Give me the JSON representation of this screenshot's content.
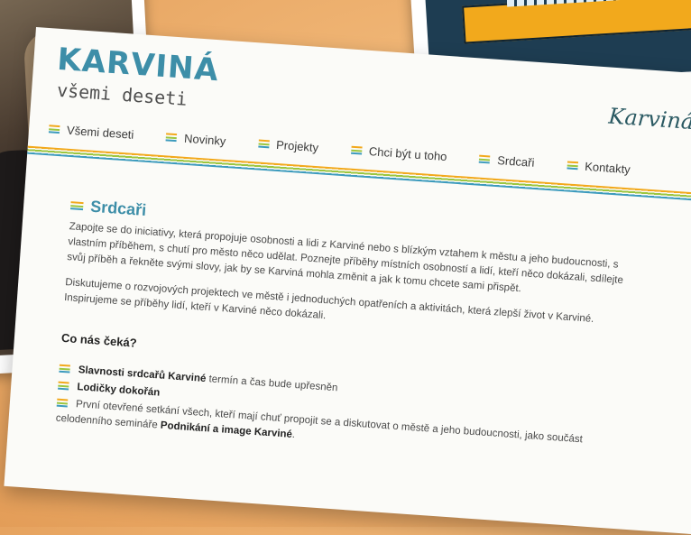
{
  "site": {
    "logo_title": "KARVINÁ",
    "logo_subtitle": "všemi deseti",
    "corner_logo": "Karviná"
  },
  "nav": {
    "items": [
      {
        "label": "Všemi deseti"
      },
      {
        "label": "Novinky"
      },
      {
        "label": "Projekty"
      },
      {
        "label": "Chci být u toho"
      },
      {
        "label": "Srdcaři"
      },
      {
        "label": "Kontakty"
      }
    ]
  },
  "page": {
    "section_title": "Srdcaři",
    "paragraph1": "Zapojte se do iniciativy, která propojuje osobnosti a lidi z Karviné nebo s blízkým vztahem k městu a jeho budoucnosti, s vlastním příběhem, s chutí pro město něco udělat. Poznejte příběhy místních osobností a lidí, kteří něco dokázali, sdílejte svůj příběh a řekněte svými slovy, jak by se Karviná mohla změnit a jak k tomu chcete sami přispět.",
    "paragraph2": "Diskutujeme o rozvojových projektech ve městě i jednoduchých opatřeních a aktivitách, která zlepší život v Karviné. Inspirujeme se příběhy lidí, kteří v Karviné něco dokázali.",
    "heading2": "Co nás čeká?",
    "list": [
      {
        "strong": "Slavnosti srdcařů Karviné",
        "text": " termín a čas bude upřesněn",
        "after": ""
      },
      {
        "strong": "Lodičky dokořán",
        "text": "",
        "after": ""
      },
      {
        "strong": "",
        "text": "První otevřené setkání všech, kteří mají chuť propojit se a diskutovat o městě a jeho budoucnosti, jako součást celodenního semináře ",
        "after": "Podnikání a image Karviné",
        "tail": "."
      }
    ]
  },
  "colors": {
    "accent_blue": "#3d8ea8",
    "accent_orange": "#f2a91c",
    "accent_green": "#9cc63f"
  }
}
